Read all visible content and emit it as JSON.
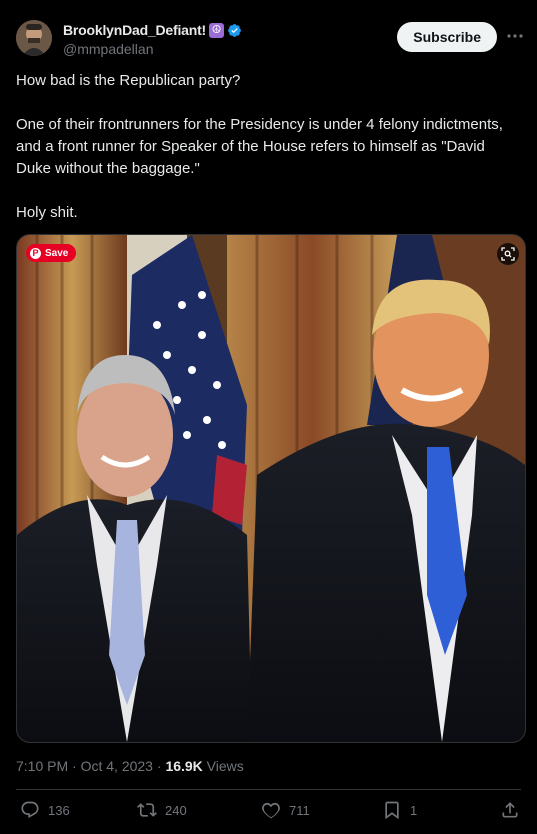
{
  "author": {
    "display_name": "BrooklynDad_Defiant!",
    "badge_emoji": "☮",
    "handle": "@mmpadellan"
  },
  "header": {
    "subscribe_label": "Subscribe",
    "more_icon": "more-horizontal-icon"
  },
  "tweet": {
    "paragraphs": [
      "How bad is the Republican party?",
      "One of their frontrunners for the Presidency is under 4 felony indictments, and a front runner for Speaker of the House refers to himself as \"David Duke without the baggage.\"",
      "Holy shit."
    ]
  },
  "media": {
    "save_label": "Save",
    "lens_icon": "visual-search-icon"
  },
  "meta": {
    "time": "7:10 PM",
    "sep1": " · ",
    "date": "Oct 4, 2023",
    "sep2": " · ",
    "views_count": "16.9K",
    "views_label": " Views"
  },
  "actions": {
    "replies": "136",
    "reposts": "240",
    "likes": "711",
    "bookmarks": "1"
  },
  "colors": {
    "background": "#000000",
    "text": "#e7e9ea",
    "muted": "#71767b",
    "verified": "#1d9bf0",
    "pinterest": "#e60023"
  }
}
